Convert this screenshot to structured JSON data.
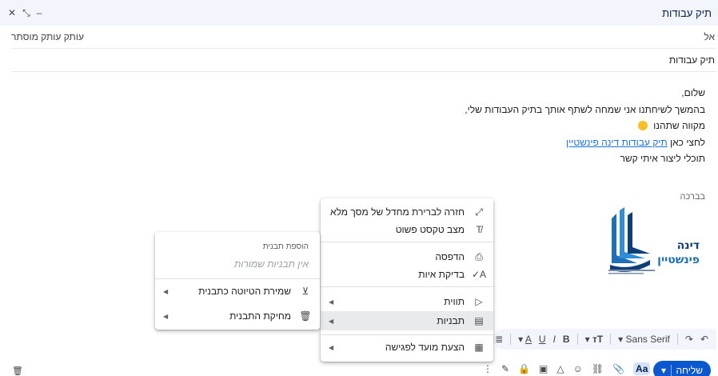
{
  "header": {
    "title": "תיק עבודות",
    "controls": {
      "close": "✕",
      "expand": "⤡",
      "minimize": "–"
    }
  },
  "to_row": {
    "label": "אל",
    "cc_bcc": "עותק עותק מוסתר"
  },
  "subject_row": {
    "value": "תיק עבודות"
  },
  "body": {
    "line1": "שלום,",
    "line2": "בהמשך לשיחתנו אני שמחה לשתף אותך בתיק העבודות שלי,",
    "line3": "מקווה שתהנו",
    "line4_prefix": "לחצי כאן",
    "line4_link": "תיק עבודות דינה פינשטיין",
    "line5": "תוכלי ליצור איתי קשר",
    "greeting": "בברכה"
  },
  "logo": {
    "name_line1": "דינה",
    "name_line2": "פינשטיין"
  },
  "main_menu": {
    "items": [
      {
        "label": "חזרה לברירת מחדל של מסך מלא",
        "icon": "expand-icon"
      },
      {
        "label": "מצב טקסט פשוט",
        "icon": "plain-text-icon"
      },
      {
        "label": "הדפסה",
        "icon": "print-icon"
      },
      {
        "label": "בדיקת איות",
        "icon": "spellcheck-icon"
      },
      {
        "label": "תווית",
        "icon": "label-icon"
      },
      {
        "label": "תבניות",
        "icon": "template-icon"
      },
      {
        "label": "הצעת מועד לפגישה",
        "icon": "calendar-icon"
      }
    ]
  },
  "sub_menu": {
    "heading": "הוספת תבנית",
    "empty": "אין תבניות שמורות",
    "items": [
      {
        "label": "שמירת הטיוטה כתבנית",
        "icon": "save-template-icon"
      },
      {
        "label": "מחיקת התבנית",
        "icon": "trash-icon"
      }
    ]
  },
  "toolbar": {
    "font": "Sans Serif"
  },
  "bottom": {
    "send_label": "שליחה",
    "aa_label": "Aa"
  },
  "colors": {
    "accent": "#0b57d0",
    "header_bg": "#f2f6fc",
    "link": "#1a73e8"
  }
}
